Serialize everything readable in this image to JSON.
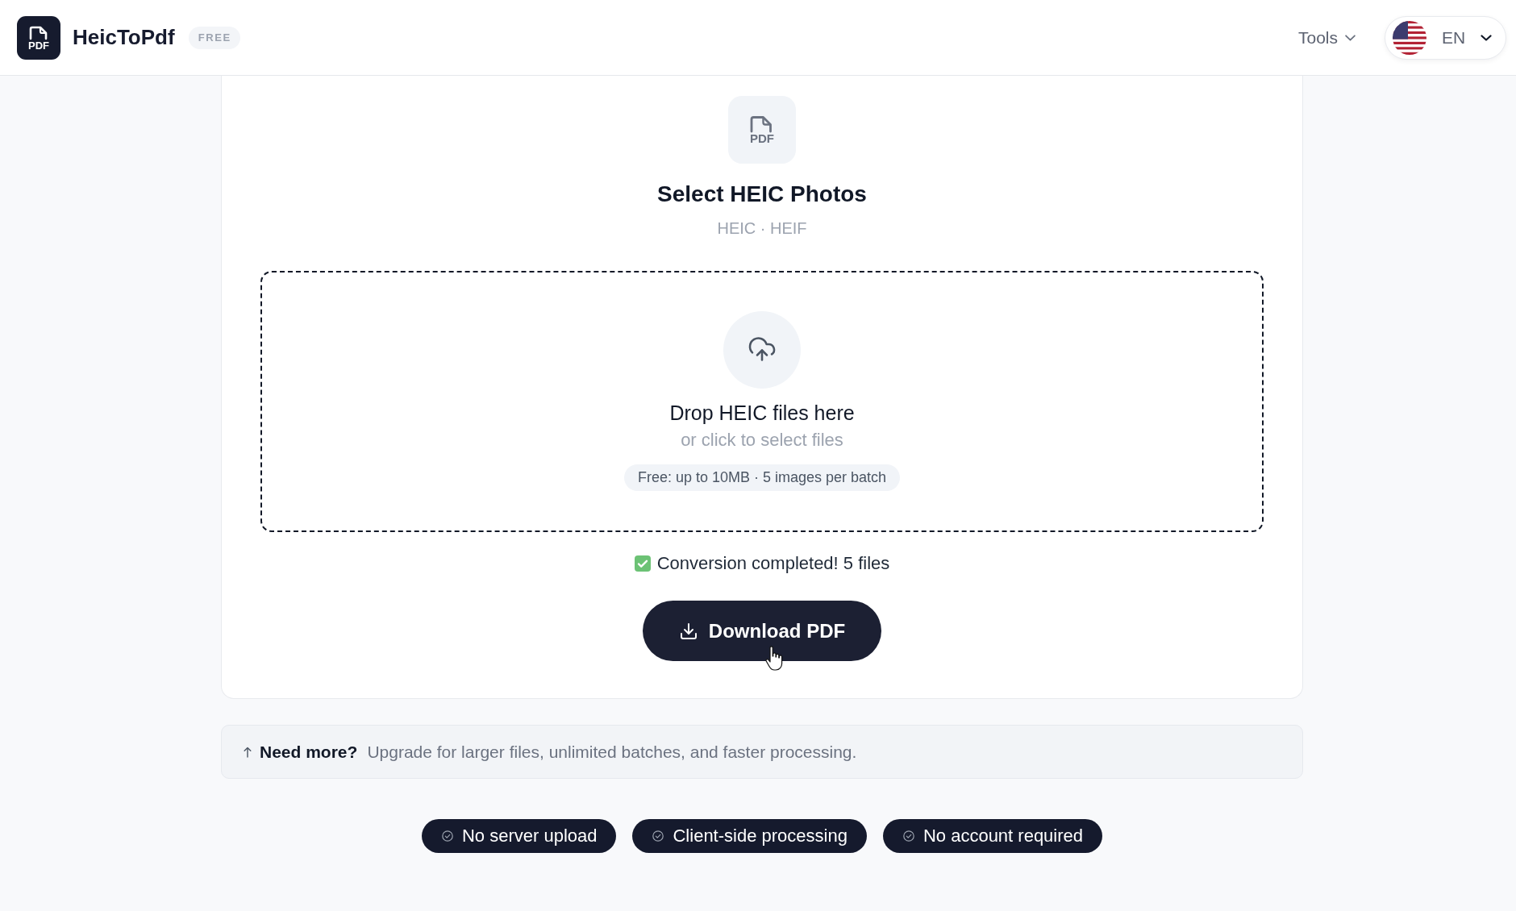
{
  "header": {
    "logo_mark": "PDF",
    "brand": "HeicToPdf",
    "plan_badge": "FREE",
    "nav": [
      {
        "label": "Tools"
      }
    ],
    "language": {
      "code": "EN"
    }
  },
  "uploader": {
    "file_icon_label": "PDF",
    "title": "Select HEIC Photos",
    "formats": "HEIC · HEIF",
    "dropzone": {
      "heading": "Drop HEIC files here",
      "hint": "or click to select files",
      "limits": "Free: up to 10MB · 5 images per batch"
    },
    "status": {
      "done": true,
      "message": "Conversion completed! 5 files"
    },
    "download_button": "Download PDF"
  },
  "upsell": {
    "lead": "Need more?",
    "text": "Upgrade for larger files, unlimited batches, and faster processing."
  },
  "badges": [
    "No server upload",
    "Client-side processing",
    "No account required"
  ]
}
